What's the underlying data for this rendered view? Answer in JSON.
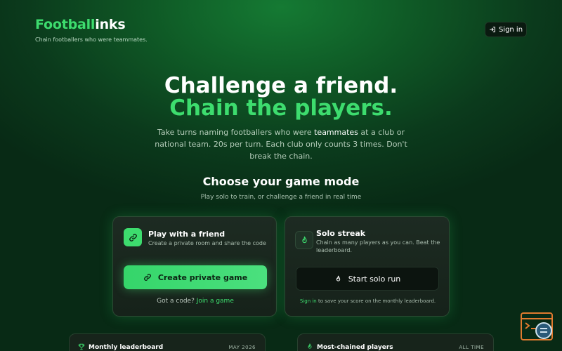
{
  "brand": {
    "logo_part1": "Football",
    "logo_part2": "inks",
    "tagline": "Chain footballers who were teammates."
  },
  "header": {
    "signin_label": "Sign in"
  },
  "hero": {
    "title": "Challenge a friend.",
    "subtitle": "Chain the players.",
    "desc_before": "Take turns naming footballers who were ",
    "desc_highlight": "teammates",
    "desc_after": " at a club or national team. 20s per turn. Each club only counts 3 times. Don't break the chain."
  },
  "mode": {
    "title": "Choose your game mode",
    "subtitle": "Play solo to train, or challenge a friend in real time"
  },
  "friend_card": {
    "title": "Play with a friend",
    "desc": "Create a private room and share the code",
    "button_label": "Create private game",
    "footer_text": "Got a code? ",
    "footer_link": "Join a game"
  },
  "solo_card": {
    "title": "Solo streak",
    "desc": "Chain as many players as you can. Beat the leaderboard.",
    "button_label": "Start solo run",
    "footer_link": "Sign in",
    "footer_text": " to save your score on the monthly leaderboard."
  },
  "leaderboards": [
    {
      "title": "Monthly leaderboard",
      "tag": "MAY 2026",
      "icon": "trophy-icon"
    },
    {
      "title": "Most-chained players",
      "tag": "ALL TIME",
      "icon": "fire-icon"
    }
  ],
  "colors": {
    "accent": "#3ddc6e",
    "background": "#0b3a1c",
    "card": "#1a271e"
  }
}
